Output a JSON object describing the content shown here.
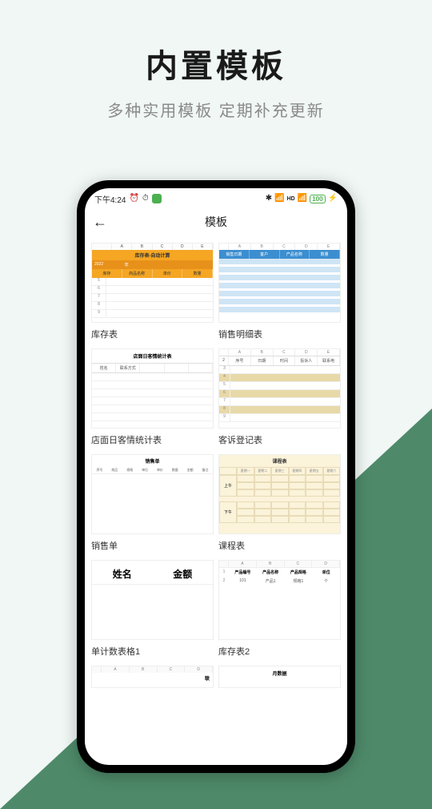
{
  "promo": {
    "title": "内置模板",
    "subtitle": "多种实用模板 定期补充更新"
  },
  "status": {
    "time": "下午4:24",
    "battery": "100"
  },
  "nav": {
    "title": "模板"
  },
  "templates": [
    {
      "label": "库存表"
    },
    {
      "label": "销售明细表"
    },
    {
      "label": "店面日客情统计表"
    },
    {
      "label": "客诉登记表"
    },
    {
      "label": "销售单"
    },
    {
      "label": "课程表"
    },
    {
      "label": "单计数表格1"
    },
    {
      "label": "库存表2"
    }
  ],
  "thumbs": {
    "t1": {
      "cols": [
        "",
        "A",
        "B",
        "C",
        "D",
        "E"
      ],
      "title": "库存表-自动计算",
      "year_row": [
        "2022",
        "年"
      ],
      "headers": [
        "库存",
        "商品名称",
        "单价",
        "数量"
      ],
      "rownums": [
        "5",
        "6",
        "7",
        "8",
        "9"
      ]
    },
    "t2": {
      "cols": [
        "A",
        "B",
        "C",
        "D",
        "E"
      ],
      "headers": [
        "销售日期",
        "客户",
        "产品名称",
        "数量"
      ]
    },
    "t3": {
      "title": "店面日客情统计表",
      "headers": [
        "姓名",
        "联系方式",
        "",
        "",
        ""
      ]
    },
    "t4": {
      "cols": [
        "A",
        "B",
        "C",
        "D",
        "E"
      ],
      "headers": [
        "序号",
        "日期",
        "时间",
        "投诉人",
        "联系电"
      ],
      "rownums": [
        "3",
        "4",
        "5",
        "6",
        "7",
        "8",
        "9"
      ]
    },
    "t5": {
      "title": "销售单",
      "headers": [
        "序号",
        "商品",
        "规格",
        "单位",
        "单价",
        "数量",
        "金额",
        "备注"
      ]
    },
    "t6": {
      "title": "课程表",
      "headers": [
        "",
        "星期一",
        "星期二",
        "星期三",
        "星期四",
        "星期五",
        "星期六"
      ],
      "am": "上午",
      "pm": "下午"
    },
    "t7": {
      "col1": "姓名",
      "col2": "金额"
    },
    "t8": {
      "cols": [
        "",
        "A",
        "B",
        "C",
        "D"
      ],
      "headers": [
        "产品编号",
        "产品名称",
        "产品规格",
        "单位"
      ],
      "row": [
        "101",
        "产品1",
        "规格1",
        "个"
      ]
    },
    "t9": {
      "cols": [
        "",
        "A",
        "B",
        "C",
        "D"
      ],
      "rt": "联"
    },
    "t10": {
      "title": "月数据"
    }
  }
}
